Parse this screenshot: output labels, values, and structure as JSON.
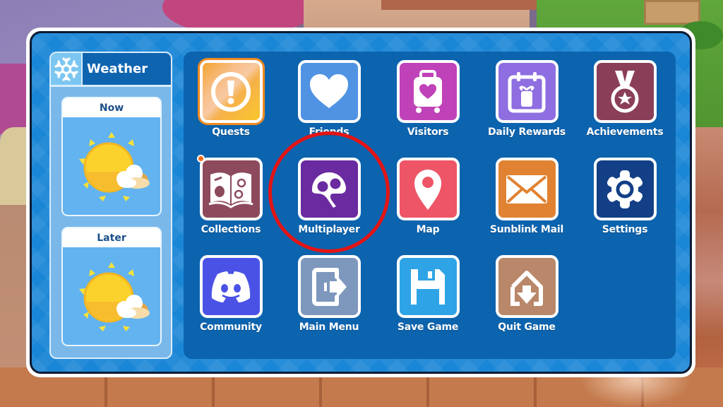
{
  "weather": {
    "title": "Weather",
    "icon": "snowflake-icon",
    "forecasts": [
      {
        "label": "Now",
        "condition": "sunny-partly-cloudy"
      },
      {
        "label": "Later",
        "condition": "sunny-partly-cloudy"
      }
    ]
  },
  "menu": {
    "items": [
      {
        "label": "Quests",
        "icon": "quest-exclamation-icon",
        "color": "#f6a233",
        "selected": true
      },
      {
        "label": "Friends",
        "icon": "heart-icon",
        "color": "#5093e3"
      },
      {
        "label": "Visitors",
        "icon": "suitcase-heart-icon",
        "color": "#c042b8"
      },
      {
        "label": "Daily Rewards",
        "icon": "calendar-gift-icon",
        "color": "#8e6ee0"
      },
      {
        "label": "Achievements",
        "icon": "medal-star-icon",
        "color": "#8b3e57"
      },
      {
        "label": "Collections",
        "icon": "open-book-icon",
        "color": "#8d4a5c",
        "notification": true
      },
      {
        "label": "Multiplayer",
        "icon": "multiplayer-icon",
        "color": "#6a2aa0",
        "highlighted": true
      },
      {
        "label": "Map",
        "icon": "map-pin-icon",
        "color": "#ee5566"
      },
      {
        "label": "Sunblink Mail",
        "icon": "envelope-icon",
        "color": "#e08232"
      },
      {
        "label": "Settings",
        "icon": "gear-icon",
        "color": "#123f86"
      },
      {
        "label": "Community",
        "icon": "discord-icon",
        "color": "#4a52e6"
      },
      {
        "label": "Main Menu",
        "icon": "exit-arrow-icon",
        "color": "#7e97bd"
      },
      {
        "label": "Save Game",
        "icon": "floppy-disk-icon",
        "color": "#2ea4e6"
      },
      {
        "label": "Quit Game",
        "icon": "home-down-icon",
        "color": "#b98769"
      }
    ]
  },
  "colors": {
    "frame_blue": "#1a86d6",
    "panel_blue": "#0c63ae",
    "highlight_ring": "#e31414",
    "notification_dot": "#f26a1b"
  }
}
